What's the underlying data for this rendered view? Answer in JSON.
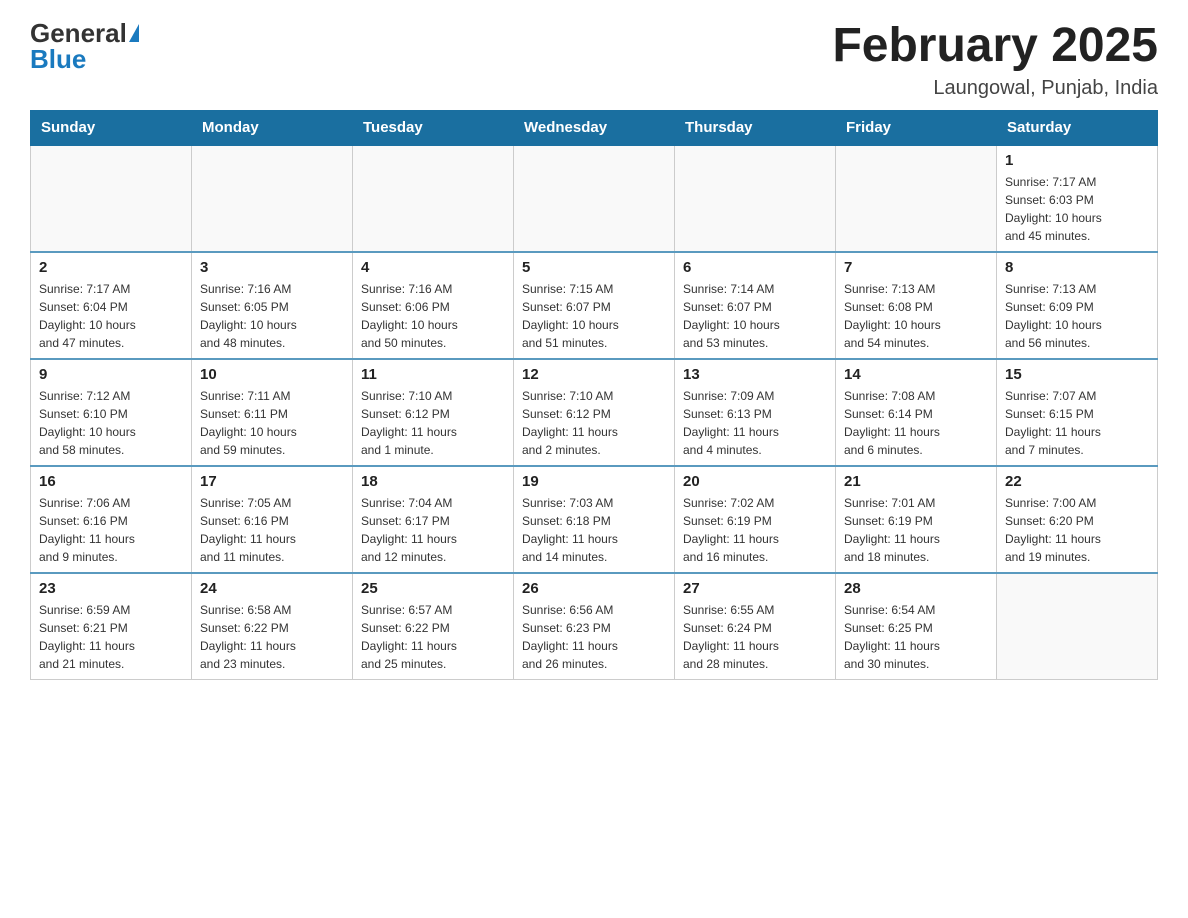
{
  "header": {
    "logo_general": "General",
    "logo_blue": "Blue",
    "title": "February 2025",
    "location": "Laungowal, Punjab, India"
  },
  "weekdays": [
    "Sunday",
    "Monday",
    "Tuesday",
    "Wednesday",
    "Thursday",
    "Friday",
    "Saturday"
  ],
  "weeks": [
    [
      {
        "day": "",
        "info": ""
      },
      {
        "day": "",
        "info": ""
      },
      {
        "day": "",
        "info": ""
      },
      {
        "day": "",
        "info": ""
      },
      {
        "day": "",
        "info": ""
      },
      {
        "day": "",
        "info": ""
      },
      {
        "day": "1",
        "info": "Sunrise: 7:17 AM\nSunset: 6:03 PM\nDaylight: 10 hours\nand 45 minutes."
      }
    ],
    [
      {
        "day": "2",
        "info": "Sunrise: 7:17 AM\nSunset: 6:04 PM\nDaylight: 10 hours\nand 47 minutes."
      },
      {
        "day": "3",
        "info": "Sunrise: 7:16 AM\nSunset: 6:05 PM\nDaylight: 10 hours\nand 48 minutes."
      },
      {
        "day": "4",
        "info": "Sunrise: 7:16 AM\nSunset: 6:06 PM\nDaylight: 10 hours\nand 50 minutes."
      },
      {
        "day": "5",
        "info": "Sunrise: 7:15 AM\nSunset: 6:07 PM\nDaylight: 10 hours\nand 51 minutes."
      },
      {
        "day": "6",
        "info": "Sunrise: 7:14 AM\nSunset: 6:07 PM\nDaylight: 10 hours\nand 53 minutes."
      },
      {
        "day": "7",
        "info": "Sunrise: 7:13 AM\nSunset: 6:08 PM\nDaylight: 10 hours\nand 54 minutes."
      },
      {
        "day": "8",
        "info": "Sunrise: 7:13 AM\nSunset: 6:09 PM\nDaylight: 10 hours\nand 56 minutes."
      }
    ],
    [
      {
        "day": "9",
        "info": "Sunrise: 7:12 AM\nSunset: 6:10 PM\nDaylight: 10 hours\nand 58 minutes."
      },
      {
        "day": "10",
        "info": "Sunrise: 7:11 AM\nSunset: 6:11 PM\nDaylight: 10 hours\nand 59 minutes."
      },
      {
        "day": "11",
        "info": "Sunrise: 7:10 AM\nSunset: 6:12 PM\nDaylight: 11 hours\nand 1 minute."
      },
      {
        "day": "12",
        "info": "Sunrise: 7:10 AM\nSunset: 6:12 PM\nDaylight: 11 hours\nand 2 minutes."
      },
      {
        "day": "13",
        "info": "Sunrise: 7:09 AM\nSunset: 6:13 PM\nDaylight: 11 hours\nand 4 minutes."
      },
      {
        "day": "14",
        "info": "Sunrise: 7:08 AM\nSunset: 6:14 PM\nDaylight: 11 hours\nand 6 minutes."
      },
      {
        "day": "15",
        "info": "Sunrise: 7:07 AM\nSunset: 6:15 PM\nDaylight: 11 hours\nand 7 minutes."
      }
    ],
    [
      {
        "day": "16",
        "info": "Sunrise: 7:06 AM\nSunset: 6:16 PM\nDaylight: 11 hours\nand 9 minutes."
      },
      {
        "day": "17",
        "info": "Sunrise: 7:05 AM\nSunset: 6:16 PM\nDaylight: 11 hours\nand 11 minutes."
      },
      {
        "day": "18",
        "info": "Sunrise: 7:04 AM\nSunset: 6:17 PM\nDaylight: 11 hours\nand 12 minutes."
      },
      {
        "day": "19",
        "info": "Sunrise: 7:03 AM\nSunset: 6:18 PM\nDaylight: 11 hours\nand 14 minutes."
      },
      {
        "day": "20",
        "info": "Sunrise: 7:02 AM\nSunset: 6:19 PM\nDaylight: 11 hours\nand 16 minutes."
      },
      {
        "day": "21",
        "info": "Sunrise: 7:01 AM\nSunset: 6:19 PM\nDaylight: 11 hours\nand 18 minutes."
      },
      {
        "day": "22",
        "info": "Sunrise: 7:00 AM\nSunset: 6:20 PM\nDaylight: 11 hours\nand 19 minutes."
      }
    ],
    [
      {
        "day": "23",
        "info": "Sunrise: 6:59 AM\nSunset: 6:21 PM\nDaylight: 11 hours\nand 21 minutes."
      },
      {
        "day": "24",
        "info": "Sunrise: 6:58 AM\nSunset: 6:22 PM\nDaylight: 11 hours\nand 23 minutes."
      },
      {
        "day": "25",
        "info": "Sunrise: 6:57 AM\nSunset: 6:22 PM\nDaylight: 11 hours\nand 25 minutes."
      },
      {
        "day": "26",
        "info": "Sunrise: 6:56 AM\nSunset: 6:23 PM\nDaylight: 11 hours\nand 26 minutes."
      },
      {
        "day": "27",
        "info": "Sunrise: 6:55 AM\nSunset: 6:24 PM\nDaylight: 11 hours\nand 28 minutes."
      },
      {
        "day": "28",
        "info": "Sunrise: 6:54 AM\nSunset: 6:25 PM\nDaylight: 11 hours\nand 30 minutes."
      },
      {
        "day": "",
        "info": ""
      }
    ]
  ]
}
